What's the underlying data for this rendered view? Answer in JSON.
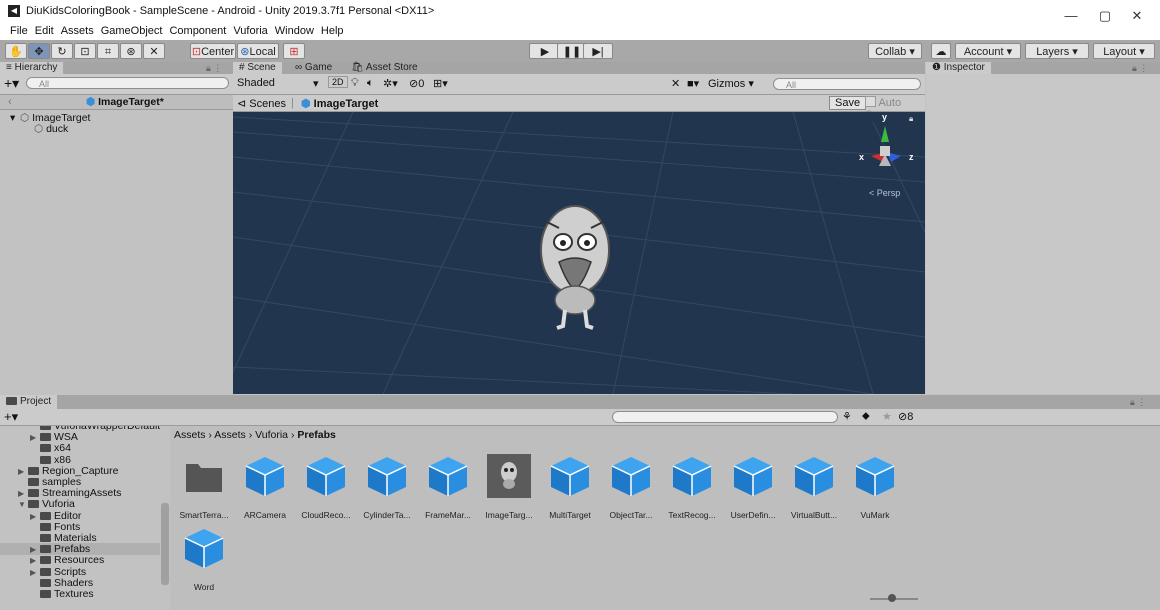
{
  "window": {
    "title": "DiuKidsColoringBook - SampleScene - Android - Unity 2019.3.7f1 Personal <DX11>",
    "minimize": "—",
    "maximize": "▢",
    "close": "✕"
  },
  "menu": [
    "File",
    "Edit",
    "Assets",
    "GameObject",
    "Component",
    "Vuforia",
    "Window",
    "Help"
  ],
  "toolbar": {
    "pivot_mode": "Center",
    "pivot_rotation": "Local",
    "collab": "Collab ▾",
    "account": "Account",
    "layers": "Layers",
    "layout": "Layout"
  },
  "hierarchy": {
    "tab": "Hierarchy",
    "search_placeholder": "All",
    "scene_header": "ImageTarget*",
    "items": [
      {
        "label": "ImageTarget",
        "depth": 0,
        "expanded": true
      },
      {
        "label": "duck",
        "depth": 1,
        "expanded": false
      }
    ]
  },
  "scene_tabs": [
    "Scene",
    "Game",
    "Asset Store"
  ],
  "scene": {
    "shading": "Shaded",
    "mode_2d": "2D",
    "gizmos": "Gizmos",
    "search_placeholder": "All",
    "fx_count": "0",
    "breadcrumb_root": "Scenes",
    "breadcrumb_prefab": "ImageTarget",
    "save": "Save",
    "auto_save": "Auto Save",
    "gizmo_x": "x",
    "gizmo_y": "y",
    "gizmo_z": "z",
    "projection": "Persp",
    "background_color": "#21354f"
  },
  "inspector": {
    "tab": "Inspector"
  },
  "project": {
    "tab": "Project",
    "count_badge": "8",
    "breadcrumb": [
      "Assets",
      "Assets",
      "Vuforia",
      "Prefabs"
    ],
    "tree": [
      {
        "label": "VuforiaWrapperDefault",
        "indent": 1,
        "arrow": false
      },
      {
        "label": "WSA",
        "indent": 1,
        "arrow": true
      },
      {
        "label": "x64",
        "indent": 1,
        "arrow": false
      },
      {
        "label": "x86",
        "indent": 1,
        "arrow": false
      },
      {
        "label": "Region_Capture",
        "indent": 0,
        "arrow": true
      },
      {
        "label": "samples",
        "indent": 0,
        "arrow": false
      },
      {
        "label": "StreamingAssets",
        "indent": 0,
        "arrow": true
      },
      {
        "label": "Vuforia",
        "indent": 0,
        "arrow": true,
        "open": true
      },
      {
        "label": "Editor",
        "indent": 1,
        "arrow": true
      },
      {
        "label": "Fonts",
        "indent": 1,
        "arrow": false
      },
      {
        "label": "Materials",
        "indent": 1,
        "arrow": false
      },
      {
        "label": "Prefabs",
        "indent": 1,
        "arrow": true,
        "selected": true
      },
      {
        "label": "Resources",
        "indent": 1,
        "arrow": true
      },
      {
        "label": "Scripts",
        "indent": 1,
        "arrow": true
      },
      {
        "label": "Shaders",
        "indent": 1,
        "arrow": false
      },
      {
        "label": "Textures",
        "indent": 1,
        "arrow": false
      }
    ],
    "assets": [
      {
        "label": "SmartTerra...",
        "kind": "folder"
      },
      {
        "label": "ARCamera",
        "kind": "prefab"
      },
      {
        "label": "CloudReco...",
        "kind": "prefab"
      },
      {
        "label": "CylinderTa...",
        "kind": "prefab"
      },
      {
        "label": "FrameMar...",
        "kind": "prefab"
      },
      {
        "label": "ImageTarg...",
        "kind": "preview"
      },
      {
        "label": "MultiTarget",
        "kind": "prefab"
      },
      {
        "label": "ObjectTar...",
        "kind": "prefab"
      },
      {
        "label": "TextRecog...",
        "kind": "prefab"
      },
      {
        "label": "UserDefin...",
        "kind": "prefab"
      },
      {
        "label": "VirtualButt...",
        "kind": "prefab"
      },
      {
        "label": "VuMark",
        "kind": "prefab"
      },
      {
        "label": "Word",
        "kind": "prefab"
      }
    ]
  }
}
